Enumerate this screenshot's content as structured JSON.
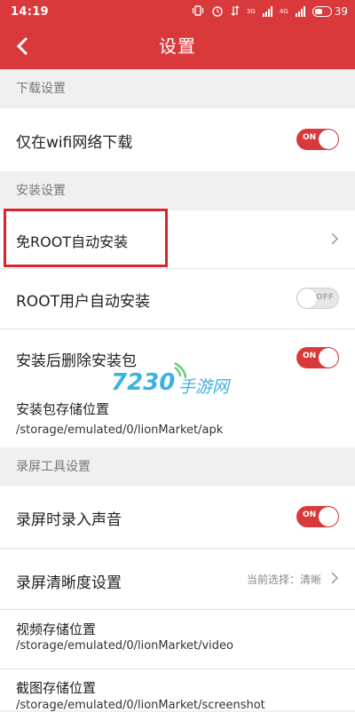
{
  "status_bar": {
    "time": "14:19",
    "icons": [
      "vibrate-icon",
      "alarm-icon",
      "data-icon",
      "signal-icon",
      "signal-4g-icon",
      "battery-icon"
    ],
    "network_3g": "3G",
    "network_4g": "4G",
    "battery": "39"
  },
  "header": {
    "title": "设置",
    "back_icon": "back-chevron-icon"
  },
  "sections": {
    "download": "下载设置",
    "install": "安装设置",
    "record": "录屏工具设置"
  },
  "rows": {
    "wifi_only": {
      "label": "仅在wifi网络下载",
      "toggle": "ON"
    },
    "root_free_install": {
      "label": "免ROOT自动安装"
    },
    "root_user_install": {
      "label": "ROOT用户自动安装",
      "toggle": "OFF"
    },
    "delete_after_install": {
      "label": "安装后删除安装包",
      "toggle": "ON"
    },
    "apk_storage": {
      "label": "安装包存储位置",
      "path": "/storage/emulated/0/lionMarket/apk"
    },
    "record_audio": {
      "label": "录屏时录入声音",
      "toggle": "ON"
    },
    "record_quality": {
      "label": "录屏清晰度设置",
      "hint": "当前选择：清晰"
    },
    "video_storage": {
      "label": "视频存储位置",
      "path": "/storage/emulated/0/lionMarket/video"
    },
    "screenshot_storage": {
      "label": "截图存储位置",
      "path": "/storage/emulated/0/lionMarket/screenshot"
    }
  },
  "watermark": {
    "number": "7230",
    "text": "手游网"
  },
  "colors": {
    "accent": "#d9393b",
    "highlight_box": "#d8252a"
  }
}
